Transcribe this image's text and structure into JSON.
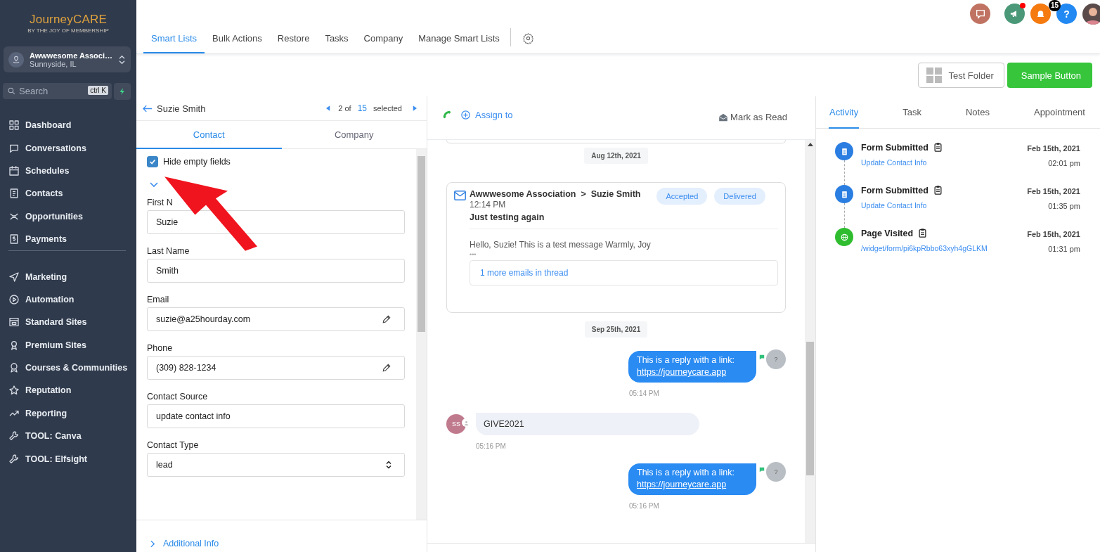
{
  "logo": {
    "name": "JourneyCARE",
    "tagline": "BY THE JOY OF MEMBERSHIP"
  },
  "account": {
    "name": "Awwwesome Associ…",
    "location": "Sunnyside, IL"
  },
  "search": {
    "placeholder": "Search",
    "shortcut": "ctrl K"
  },
  "nav_groups": [
    {
      "items": [
        {
          "label": "Dashboard"
        },
        {
          "label": "Conversations"
        },
        {
          "label": "Schedules"
        },
        {
          "label": "Contacts"
        },
        {
          "label": "Opportunities"
        },
        {
          "label": "Payments"
        }
      ]
    },
    {
      "items": [
        {
          "label": "Marketing"
        },
        {
          "label": "Automation"
        },
        {
          "label": "Standard Sites"
        },
        {
          "label": "Premium Sites"
        },
        {
          "label": "Courses & Communities"
        },
        {
          "label": "Reputation"
        },
        {
          "label": "Reporting"
        },
        {
          "label": "TOOL: Canva"
        },
        {
          "label": "TOOL: Elfsight"
        }
      ]
    }
  ],
  "top_tabs": [
    {
      "label": "Smart Lists",
      "selected": true
    },
    {
      "label": "Bulk Actions",
      "selected": false
    },
    {
      "label": "Restore",
      "selected": false
    },
    {
      "label": "Tasks",
      "selected": false
    },
    {
      "label": "Company",
      "selected": false
    },
    {
      "label": "Manage Smart Lists",
      "selected": false
    }
  ],
  "header_icons": {
    "announcements_unread": true,
    "notification_count": "15",
    "help": "?"
  },
  "toolbar": {
    "folder_button": "Test Folder",
    "primary_button": "Sample Button"
  },
  "contact_panel": {
    "name": "Suzie Smith",
    "pager": {
      "prefix": "2 of",
      "total": "15",
      "suffix": "selected"
    },
    "tabs": [
      {
        "label": "Contact",
        "selected": true
      },
      {
        "label": "Company",
        "selected": false
      }
    ],
    "hide_empty": {
      "label": "Hide empty fields",
      "checked": true
    },
    "fields": [
      {
        "label": "First N",
        "value": "Suzie",
        "kind": "text"
      },
      {
        "label": "Last Name",
        "value": "Smith",
        "kind": "text"
      },
      {
        "label": "Email",
        "value": "suzie@a25hourday.com",
        "kind": "editable"
      },
      {
        "label": "Phone",
        "value": "(309) 828-1234",
        "kind": "editable"
      },
      {
        "label": "Contact Source",
        "value": "update contact info",
        "kind": "text"
      },
      {
        "label": "Contact Type",
        "value": "lead",
        "kind": "select"
      }
    ],
    "section": {
      "label": "Additional Info",
      "expanded": false
    }
  },
  "conversation": {
    "assign_label": "Assign to",
    "mark_read_label": "Mark as Read",
    "items": [
      {
        "kind": "date",
        "label": "Aug 12th, 2021"
      },
      {
        "kind": "email",
        "from": "Awwwesome Association",
        "separator": ">",
        "to": "Suzie Smith",
        "time": "12:14 PM",
        "subject": "Just testing again",
        "badges": [
          "Accepted",
          "Delivered"
        ],
        "body": "Hello, Suzie! This is a test message Warmly, Joy",
        "more": "•••",
        "thread_link": "1 more emails in thread"
      },
      {
        "kind": "date",
        "label": "Sep 25th, 2021"
      },
      {
        "kind": "outgoing",
        "text": "This is a reply with a link:",
        "link": "https://journeycare.app",
        "avatar": "?",
        "time": "05:14 PM"
      },
      {
        "kind": "incoming",
        "text": "GIVE2021",
        "avatar": "SS",
        "time": "05:16 PM"
      },
      {
        "kind": "outgoing",
        "text": "This is a reply with a link:",
        "link": "https://journeycare.app",
        "avatar": "?",
        "time": "05:16 PM"
      }
    ]
  },
  "activity": {
    "tabs": [
      {
        "label": "Activity",
        "selected": true
      },
      {
        "label": "Task",
        "selected": false
      },
      {
        "label": "Notes",
        "selected": false
      },
      {
        "label": "Appointment",
        "selected": false
      }
    ],
    "events": [
      {
        "kind": "form",
        "title": "Form Submitted",
        "detail": "Update Contact Info",
        "date": "Feb 15th, 2021",
        "time": "02:01 pm"
      },
      {
        "kind": "form",
        "title": "Form Submitted",
        "detail": "Update Contact Info",
        "date": "Feb 15th, 2021",
        "time": "01:35 pm"
      },
      {
        "kind": "page",
        "title": "Page Visited",
        "detail": "/widget/form/pi6kpRbbo63xyh4gGLKM",
        "date": "Feb 15th, 2021",
        "time": "01:31 pm"
      }
    ]
  }
}
